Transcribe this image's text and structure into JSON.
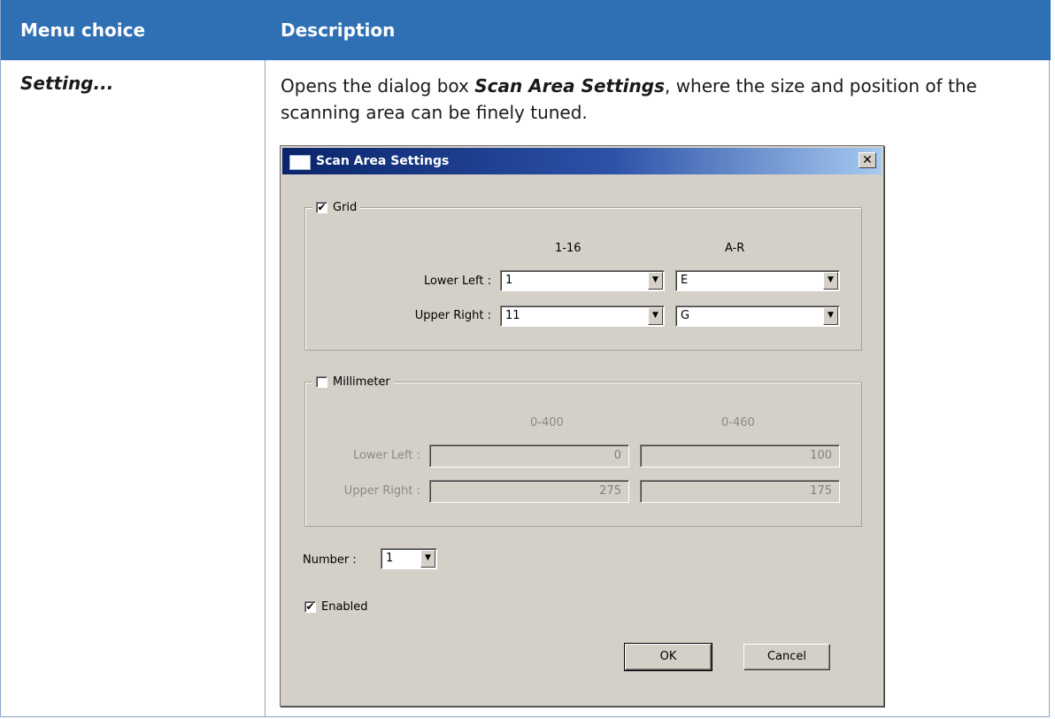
{
  "table": {
    "header": {
      "col1": "Menu choice",
      "col2": "Description"
    },
    "row": {
      "term": "Setting...",
      "desc_prefix": "Opens the dialog box ",
      "desc_emph": "Scan Area Settings",
      "desc_suffix": ", where the size and position of the scanning area can be finely tuned."
    }
  },
  "dialog": {
    "title": "Scan Area Settings",
    "close_glyph": "✕",
    "grid": {
      "label": "Grid",
      "checked": true,
      "col1_header": "1-16",
      "col2_header": "A-R",
      "lower_left_label": "Lower Left :",
      "upper_right_label": "Upper Right :",
      "lower_left_num": "1",
      "lower_left_letter": "E",
      "upper_right_num": "11",
      "upper_right_letter": "G"
    },
    "millimeter": {
      "label": "Millimeter",
      "checked": false,
      "col1_header": "0-400",
      "col2_header": "0-460",
      "lower_left_label": "Lower Left :",
      "upper_right_label": "Upper Right :",
      "lower_left_x": "0",
      "lower_left_y": "100",
      "upper_right_x": "275",
      "upper_right_y": "175"
    },
    "number_label": "Number :",
    "number_value": "1",
    "enabled_label": "Enabled",
    "enabled_checked": true,
    "ok_label": "OK",
    "cancel_label": "Cancel",
    "check_glyph": "✔",
    "dropdown_glyph": "▼"
  }
}
